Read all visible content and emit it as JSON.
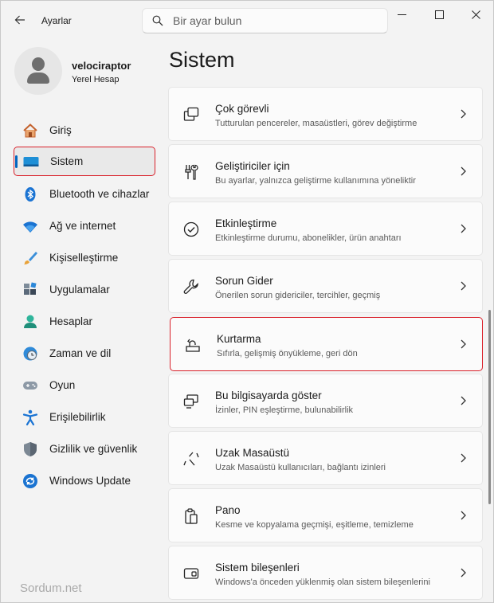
{
  "window": {
    "app_title": "Ayarlar",
    "back_icon": "arrow-left-icon",
    "search_placeholder": "Bir ayar bulun",
    "controls": [
      "minimize-icon",
      "maximize-icon",
      "close-icon"
    ]
  },
  "profile": {
    "name": "velociraptor",
    "account_type": "Yerel Hesap"
  },
  "sidebar": {
    "items": [
      {
        "label": "Giriş",
        "icon": "home-icon"
      },
      {
        "label": "Sistem",
        "icon": "system-display-icon",
        "active": true
      },
      {
        "label": "Bluetooth ve cihazlar",
        "icon": "bluetooth-icon"
      },
      {
        "label": "Ağ ve internet",
        "icon": "wifi-icon"
      },
      {
        "label": "Kişiselleştirme",
        "icon": "brush-icon"
      },
      {
        "label": "Uygulamalar",
        "icon": "apps-icon"
      },
      {
        "label": "Hesaplar",
        "icon": "person-icon"
      },
      {
        "label": "Zaman ve dil",
        "icon": "clock-globe-icon"
      },
      {
        "label": "Oyun",
        "icon": "gamepad-icon"
      },
      {
        "label": "Erişilebilirlik",
        "icon": "accessibility-icon"
      },
      {
        "label": "Gizlilik ve güvenlik",
        "icon": "shield-icon"
      },
      {
        "label": "Windows Update",
        "icon": "update-icon"
      }
    ]
  },
  "main": {
    "title": "Sistem",
    "cards": [
      {
        "title": "Çok görevli",
        "subtitle": "Tutturulan pencereler, masaüstleri, görev değiştirme",
        "icon": "multitasking-icon"
      },
      {
        "title": "Geliştiriciler için",
        "subtitle": "Bu ayarlar, yalnızca geliştirme kullanımına yöneliktir",
        "icon": "developer-tools-icon"
      },
      {
        "title": "Etkinleştirme",
        "subtitle": "Etkinleştirme durumu, abonelikler, ürün anahtarı",
        "icon": "activation-check-icon"
      },
      {
        "title": "Sorun Gider",
        "subtitle": "Önerilen sorun gidericiler, tercihler, geçmiş",
        "icon": "wrench-icon"
      },
      {
        "title": "Kurtarma",
        "subtitle": "Sıfırla, gelişmiş önyükleme, geri dön",
        "icon": "recovery-icon",
        "highlighted": true
      },
      {
        "title": "Bu bilgisayarda göster",
        "subtitle": "İzinler, PIN eşleştirme, bulunabilirlik",
        "icon": "project-screen-icon"
      },
      {
        "title": "Uzak Masaüstü",
        "subtitle": "Uzak Masaüstü kullanıcıları, bağlantı izinleri",
        "icon": "remote-desktop-icon"
      },
      {
        "title": "Pano",
        "subtitle": "Kesme ve kopyalama geçmişi, eşitleme, temizleme",
        "icon": "clipboard-icon"
      },
      {
        "title": "Sistem bileşenleri",
        "subtitle": "Windows'a önceden yüklenmiş olan sistem bileşenlerini",
        "icon": "system-components-icon"
      }
    ]
  },
  "watermark": "Sordum.net",
  "colors": {
    "accent": "#0067c0",
    "highlight_border": "#d9202a",
    "background": "#f3f3f3",
    "card": "#fbfbfb"
  }
}
